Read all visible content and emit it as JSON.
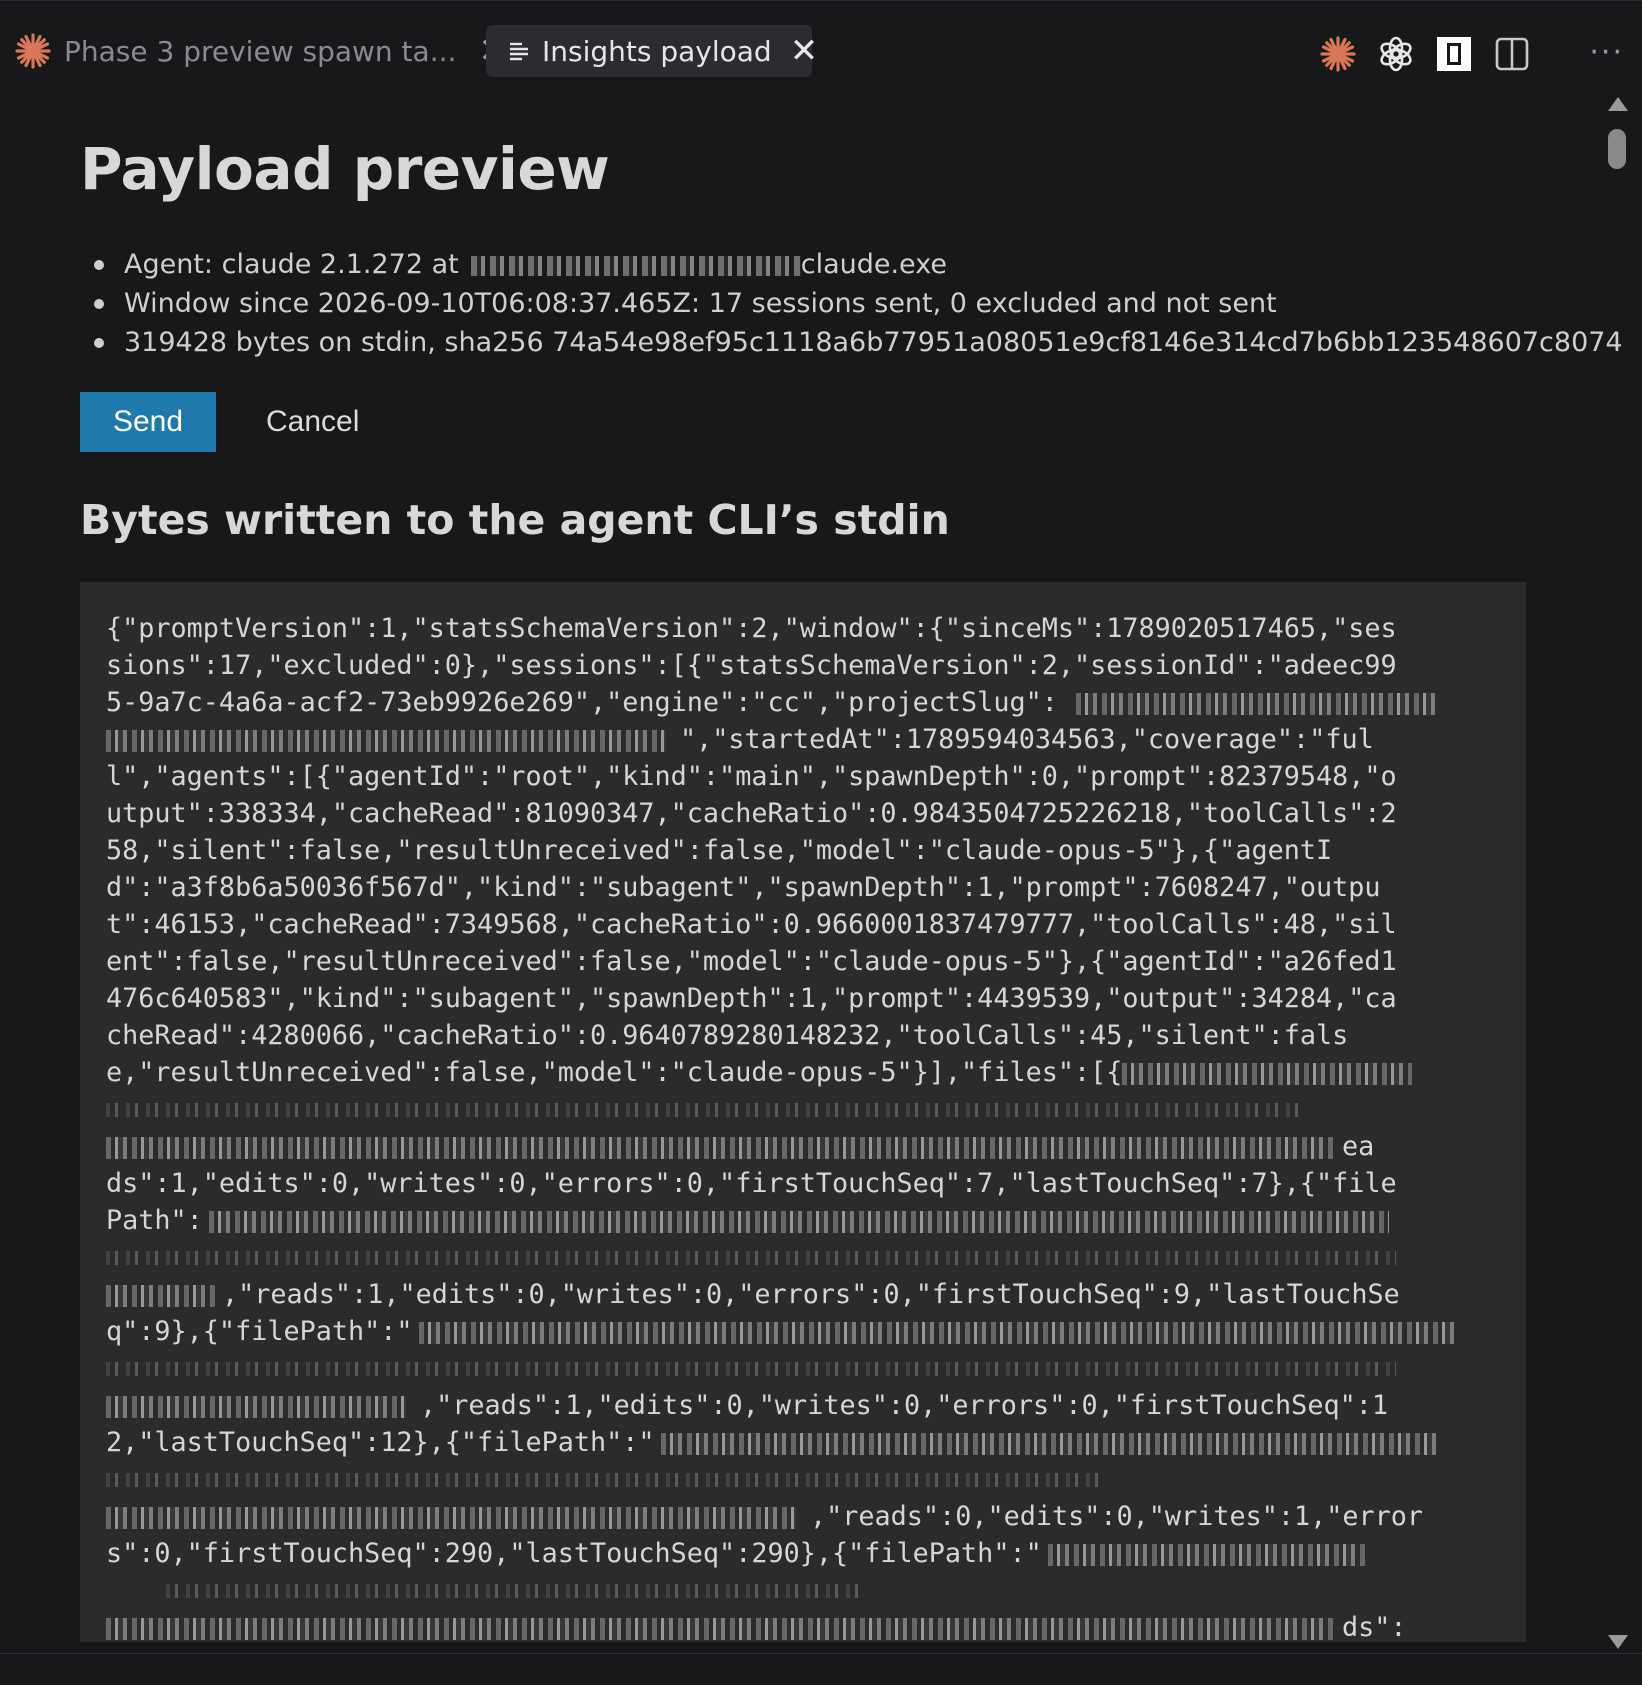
{
  "tabs": [
    {
      "label": "Phase 3 preview spawn ta...",
      "icon": "claude-asterisk-icon",
      "active": false
    },
    {
      "label": "Insights payload",
      "icon": "lines-icon",
      "active": true
    }
  ],
  "tab_close_glyph": "✕",
  "actions": [
    "claude-icon",
    "openai-icon",
    "panel-icon",
    "split-editor-icon",
    "more-icon"
  ],
  "more_glyph": "···",
  "page": {
    "title": "Payload preview",
    "summary": {
      "agent_prefix": "Agent: claude 2.1.272 at",
      "agent_suffix": "claude.exe",
      "window": "Window since 2026-09-10T06:08:37.465Z: 17 sessions sent, 0 excluded and not sent",
      "bytes": "319428 bytes on stdin, sha256 74a54e98ef95c1118a6b77951a08051e9cf8146e314cd7b6bb123548607c8074"
    },
    "send_label": "Send",
    "cancel_label": "Cancel",
    "section_title": "Bytes written to the agent CLI’s stdin",
    "code": {
      "l1": "{\"promptVersion\":1,\"statsSchemaVersion\":2,\"window\":{\"sinceMs\":1789020517465,\"ses",
      "l2": "sions\":17,\"excluded\":0},\"sessions\":[{\"statsSchemaVersion\":2,\"sessionId\":\"adeec99",
      "l3": "5-9a7c-4a6a-acf2-73eb9926e269\",\"engine\":\"cc\",\"projectSlug\":",
      "l4": "\",\"startedAt\":1789594034563,\"coverage\":\"ful",
      "l5": "l\",\"agents\":[{\"agentId\":\"root\",\"kind\":\"main\",\"spawnDepth\":0,\"prompt\":82379548,\"o",
      "l6": "utput\":338334,\"cacheRead\":81090347,\"cacheRatio\":0.9843504725226218,\"toolCalls\":2",
      "l7": "58,\"silent\":false,\"resultUnreceived\":false,\"model\":\"claude-opus-5\"},{\"agentI",
      "l8": "d\":\"a3f8b6a50036f567d\",\"kind\":\"subagent\",\"spawnDepth\":1,\"prompt\":7608247,\"outpu",
      "l9": "t\":46153,\"cacheRead\":7349568,\"cacheRatio\":0.9660001837479777,\"toolCalls\":48,\"sil",
      "l10": "ent\":false,\"resultUnreceived\":false,\"model\":\"claude-opus-5\"},{\"agentId\":\"a26fed1",
      "l11": "476c640583\",\"kind\":\"subagent\",\"spawnDepth\":1,\"prompt\":4439539,\"output\":34284,\"ca",
      "l12": "cheRead\":4280066,\"cacheRatio\":0.9640789280148232,\"toolCalls\":45,\"silent\":fals",
      "l13": "e,\"resultUnreceived\":false,\"model\":\"claude-opus-5\"}],\"files\":[{",
      "l15": "ea",
      "l16": "ds\":1,\"edits\":0,\"writes\":0,\"errors\":0,\"firstTouchSeq\":7,\"lastTouchSeq\":7},{\"file",
      "l17": "Path\":",
      "l19": ",\"reads\":1,\"edits\":0,\"writes\":0,\"errors\":0,\"firstTouchSeq\":9,\"lastTouchSe",
      "l20": "q\":9},{\"filePath\":\"",
      "l22": ",\"reads\":1,\"edits\":0,\"writes\":0,\"errors\":0,\"firstTouchSeq\":1",
      "l23": "2,\"lastTouchSeq\":12},{\"filePath\":\"",
      "l25": ",\"reads\":0,\"edits\":0,\"writes\":1,\"error",
      "l26": "s\":0,\"firstTouchSeq\":290,\"lastTouchSeq\":290},{\"filePath\":\"",
      "l28": "ds\":"
    }
  }
}
